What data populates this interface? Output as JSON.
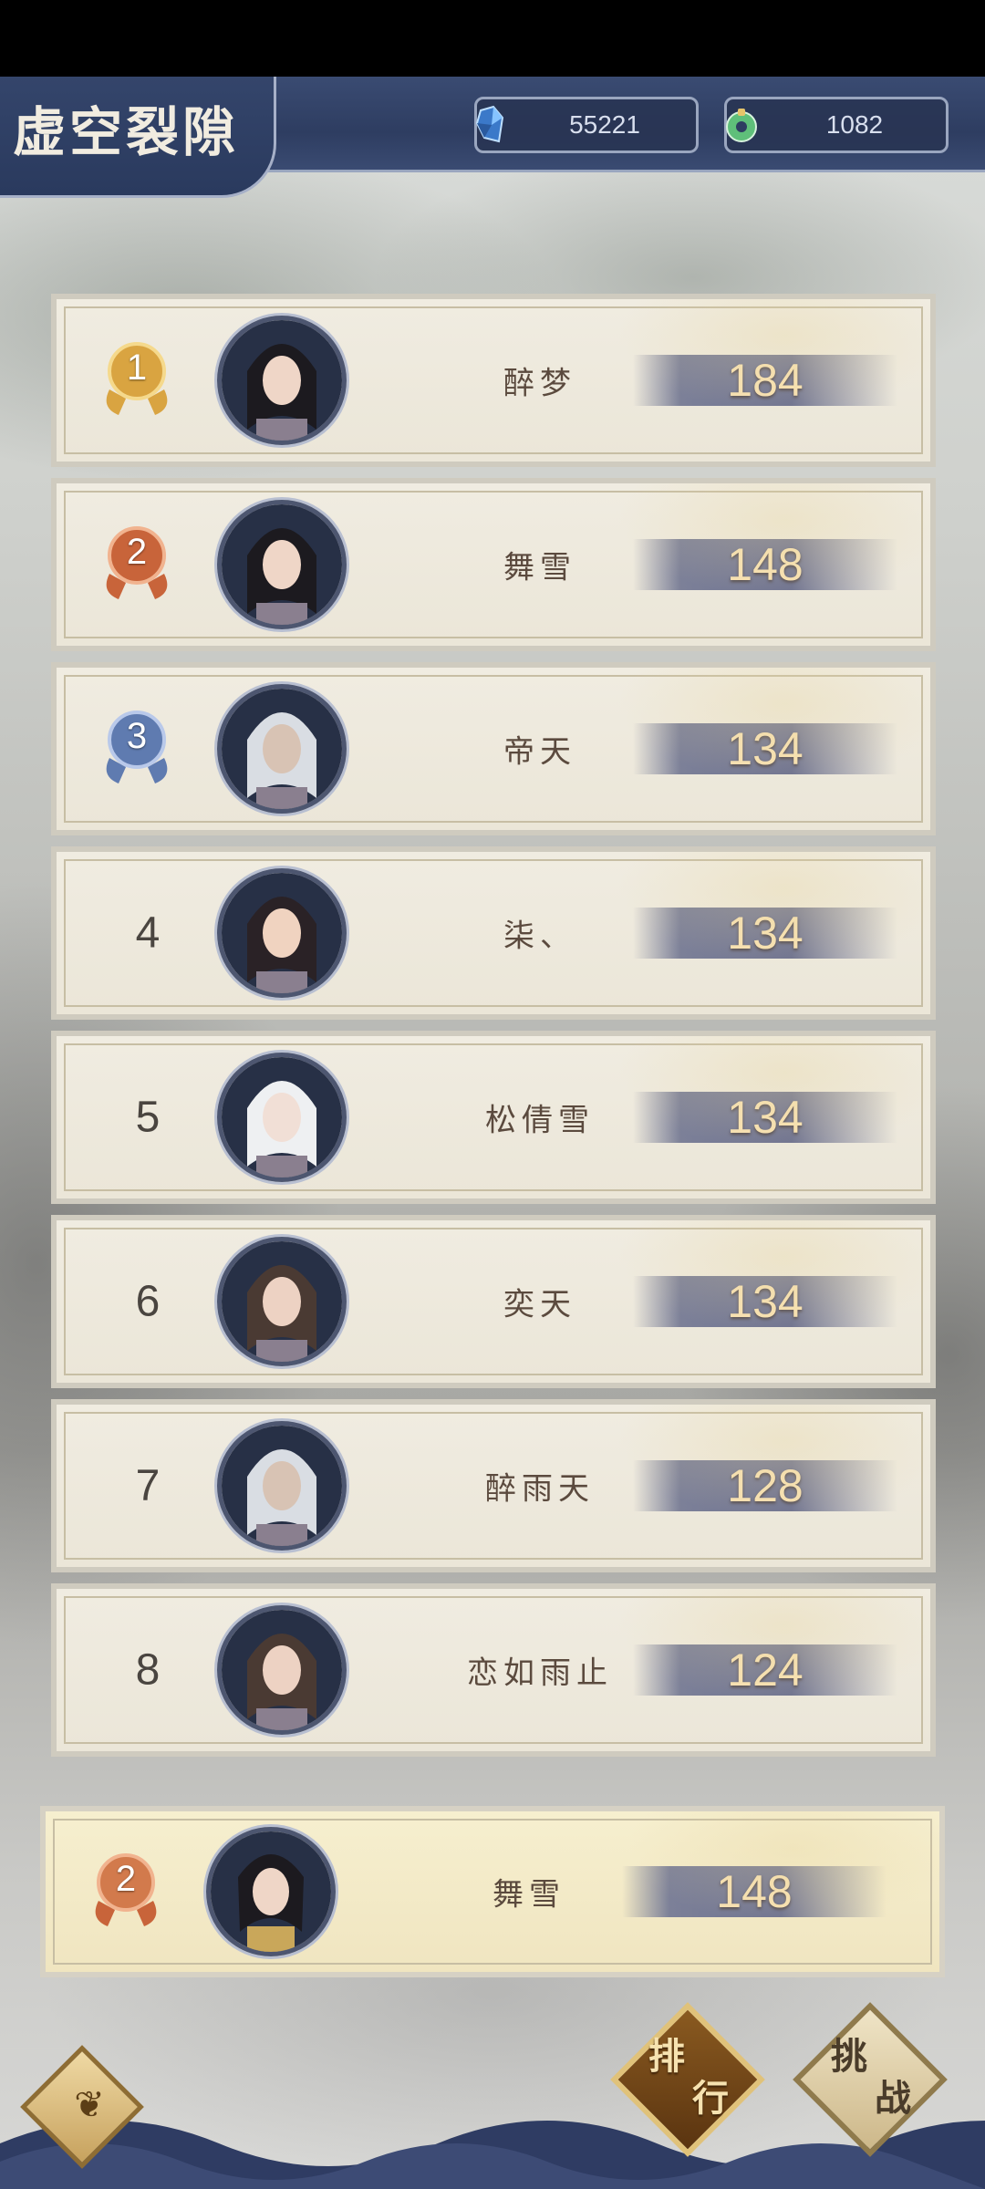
{
  "header": {
    "title": "虚空裂隙",
    "currency_gem": "55221",
    "currency_jade": "1082"
  },
  "ranking": [
    {
      "rank": "1",
      "name": "醉梦",
      "score": "184",
      "medal": "gold"
    },
    {
      "rank": "2",
      "name": "舞雪",
      "score": "148",
      "medal": "bronze"
    },
    {
      "rank": "3",
      "name": "帝天",
      "score": "134",
      "medal": "silver"
    },
    {
      "rank": "4",
      "name": "柒、",
      "score": "134"
    },
    {
      "rank": "5",
      "name": "松倩雪",
      "score": "134"
    },
    {
      "rank": "6",
      "name": "奕天",
      "score": "134"
    },
    {
      "rank": "7",
      "name": "醉雨天",
      "score": "128"
    },
    {
      "rank": "8",
      "name": "恋如雨止",
      "score": "124"
    }
  ],
  "self_entry": {
    "rank": "2",
    "name": "舞雪",
    "score": "148",
    "medal": "bronze"
  },
  "buttons": {
    "rank_top": "排",
    "rank_bottom": "行",
    "challenge_top": "挑",
    "challenge_bottom": "战"
  },
  "colors": {
    "header_bg": "#2e3d61",
    "score_text": "#f7e1b2",
    "medal_gold": "#d9a441",
    "medal_bronze": "#c8643a",
    "medal_silver": "#5f7bb0"
  },
  "icons": {
    "gem": "blue-crystal-icon",
    "jade": "jade-ring-icon",
    "back": "back-ornament-icon"
  }
}
